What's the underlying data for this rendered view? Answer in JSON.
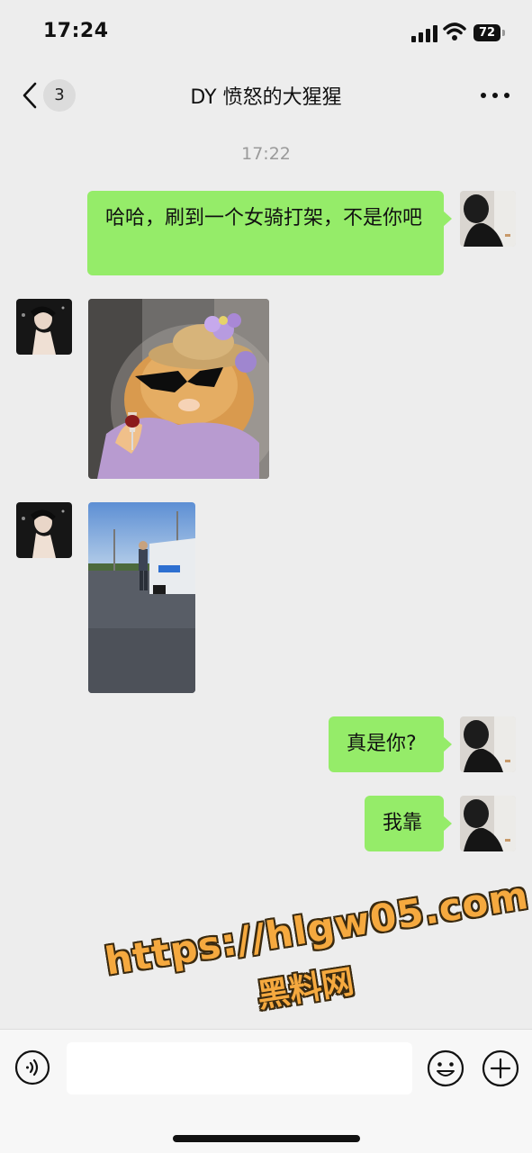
{
  "status": {
    "time": "17:24",
    "battery": "72"
  },
  "header": {
    "unread_count": "3",
    "title": "DY 愤怒的大猩猩"
  },
  "chat": {
    "timestamp": "17:22",
    "messages": [
      {
        "side": "right",
        "type": "text",
        "text": "哈哈，刷到一个女骑打架，不是你吧"
      },
      {
        "side": "left",
        "type": "image",
        "description": "cat-with-sunglasses"
      },
      {
        "side": "left",
        "type": "image",
        "description": "road-photo"
      },
      {
        "side": "right",
        "type": "text",
        "text": "真是你?"
      },
      {
        "side": "right",
        "type": "text",
        "text": "我靠"
      }
    ]
  },
  "watermark": {
    "line1": "https://hlgw05.com",
    "line2": "黑料网"
  },
  "input_bar": {
    "placeholder": ""
  },
  "colors": {
    "bubble_green": "#95ec69",
    "background": "#ededed",
    "watermark_orange": "#f5a93f"
  }
}
